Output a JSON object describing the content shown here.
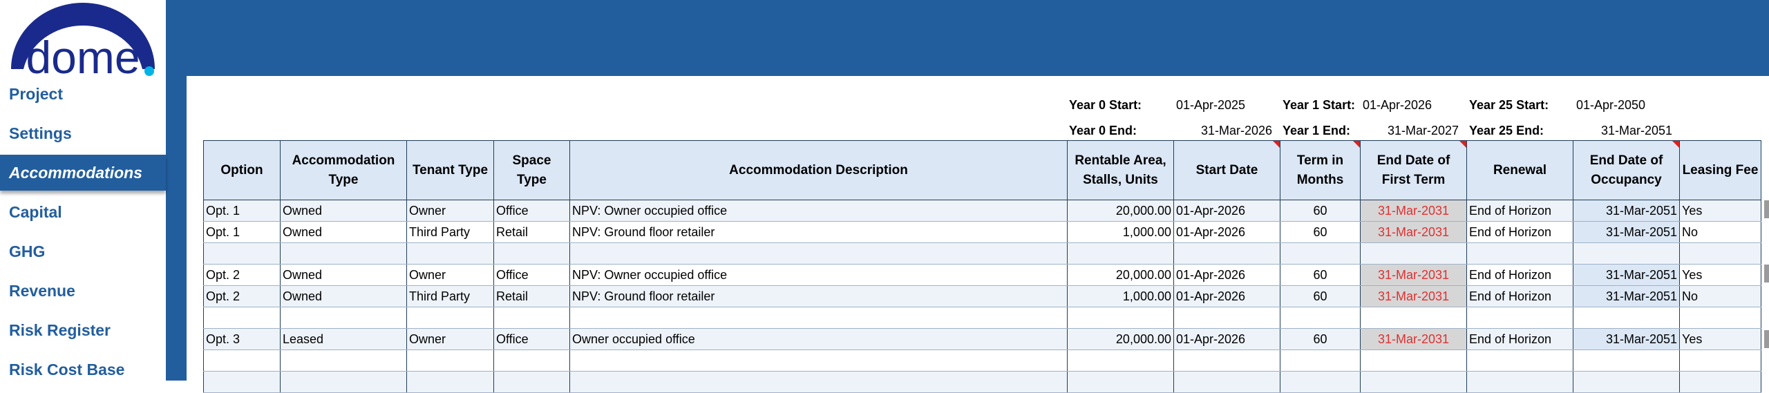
{
  "logo": {
    "text": "dome"
  },
  "nav": [
    "Project",
    "Settings",
    "Accommodations",
    "Capital",
    "GHG",
    "Revenue",
    "Risk Register",
    "Risk Cost Base"
  ],
  "active_nav": "Accommodations",
  "dates": {
    "year0_start_label": "Year 0 Start:",
    "year0_start": "01-Apr-2025",
    "year0_end_label": "Year 0 End:",
    "year0_end": "31-Mar-2026",
    "year1_start_label": "Year 1 Start:",
    "year1_start": "01-Apr-2026",
    "year1_end_label": "Year 1 End:",
    "year1_end": "31-Mar-2027",
    "year25_start_label": "Year 25 Start:",
    "year25_start": "01-Apr-2050",
    "year25_end_label": "Year 25 End:",
    "year25_end": "31-Mar-2051"
  },
  "table": {
    "headers": [
      "Option",
      "Accommodation Type",
      "Tenant Type",
      "Space Type",
      "Accommodation Description",
      "Rentable Area, Stalls, Units",
      "Start Date",
      "Term in Months",
      "End Date of First Term",
      "Renewal",
      "End Date of Occupancy",
      "Leasing Fee"
    ],
    "rows": [
      [
        "Opt. 1",
        "Owned",
        "Owner",
        "Office",
        "NPV: Owner occupied office",
        "20,000.00",
        "01-Apr-2026",
        "60",
        "31-Mar-2031",
        "End of Horizon",
        "31-Mar-2051",
        "Yes"
      ],
      [
        "Opt. 1",
        "Owned",
        "Third Party",
        "Retail",
        "NPV: Ground floor retailer",
        "1,000.00",
        "01-Apr-2026",
        "60",
        "31-Mar-2031",
        "End of Horizon",
        "31-Mar-2051",
        "No"
      ],
      [
        "",
        "",
        "",
        "",
        "",
        "",
        "",
        "",
        "",
        "",
        "",
        ""
      ],
      [
        "Opt. 2",
        "Owned",
        "Owner",
        "Office",
        "NPV: Owner occupied office",
        "20,000.00",
        "01-Apr-2026",
        "60",
        "31-Mar-2031",
        "End of Horizon",
        "31-Mar-2051",
        "Yes"
      ],
      [
        "Opt. 2",
        "Owned",
        "Third Party",
        "Retail",
        "NPV: Ground floor retailer",
        "1,000.00",
        "01-Apr-2026",
        "60",
        "31-Mar-2031",
        "End of Horizon",
        "31-Mar-2051",
        "No"
      ],
      [
        "",
        "",
        "",
        "",
        "",
        "",
        "",
        "",
        "",
        "",
        "",
        ""
      ],
      [
        "Opt. 3",
        "Leased",
        "Owner",
        "Office",
        "Owner occupied office",
        "20,000.00",
        "01-Apr-2026",
        "60",
        "31-Mar-2031",
        "End of Horizon",
        "31-Mar-2051",
        "Yes"
      ],
      [
        "",
        "",
        "",
        "",
        "",
        "",
        "",
        "",
        "",
        "",
        "",
        ""
      ],
      [
        "",
        "",
        "",
        "",
        "",
        "",
        "",
        "",
        "",
        "",
        "",
        ""
      ]
    ]
  }
}
